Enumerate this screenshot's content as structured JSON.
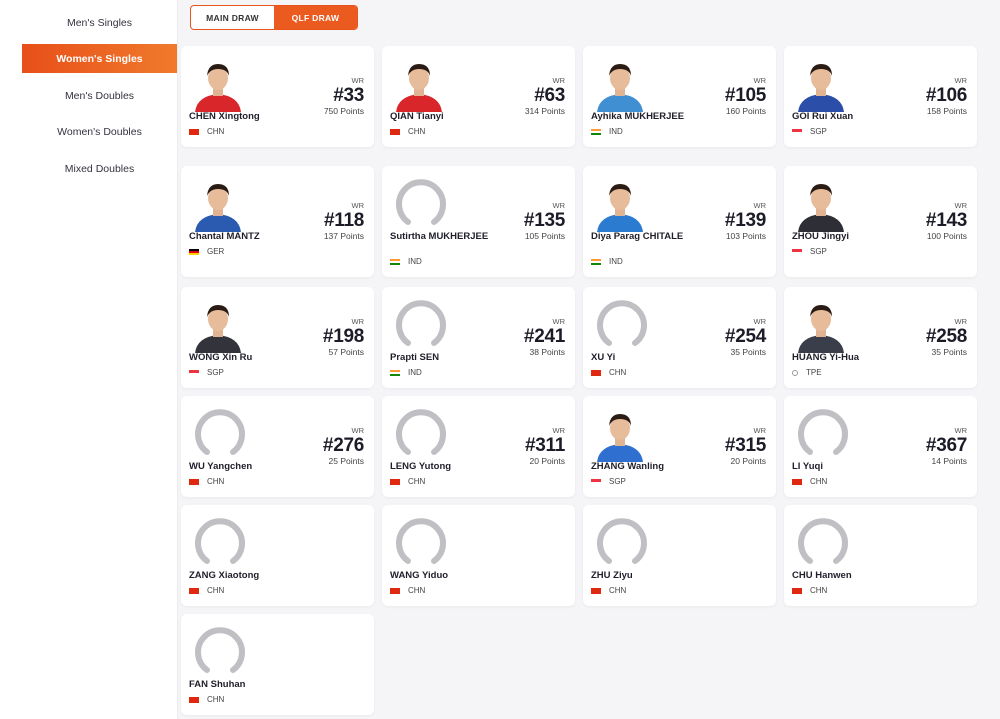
{
  "sidebar": {
    "items": [
      {
        "label": "Men's Singles",
        "active": false
      },
      {
        "label": "Women's Singles",
        "active": true
      },
      {
        "label": "Men's Doubles",
        "active": false
      },
      {
        "label": "Women's Doubles",
        "active": false
      },
      {
        "label": "Mixed Doubles",
        "active": false
      }
    ]
  },
  "tabs": [
    {
      "label": "MAIN DRAW",
      "active": false
    },
    {
      "label": "QLF DRAW",
      "active": true
    }
  ],
  "colors": {
    "accent": "#eb5a1f",
    "chn": "#de2910",
    "sgp": "#ef3340",
    "ind_saffron": "#ff9933",
    "ind_green": "#138808",
    "ger_black": "#000000",
    "ger_red": "#dd0000",
    "ger_gold": "#ffce00"
  },
  "players": [
    {
      "name": "CHEN Xingtong",
      "country": "CHN",
      "wr": "WR",
      "rank": "#33",
      "points": "750 Points",
      "photo": true,
      "shirt": "#d9262b"
    },
    {
      "name": "QIAN Tianyi",
      "country": "CHN",
      "wr": "WR",
      "rank": "#63",
      "points": "314 Points",
      "photo": true,
      "shirt": "#d9262b"
    },
    {
      "name": "Ayhika MUKHERJEE",
      "country": "IND",
      "wr": "WR",
      "rank": "#105",
      "points": "160 Points",
      "photo": true,
      "shirt": "#3f8fd2"
    },
    {
      "name": "GOI Rui Xuan",
      "country": "SGP",
      "wr": "WR",
      "rank": "#106",
      "points": "158 Points",
      "photo": true,
      "shirt": "#2b4fa8"
    },
    {
      "name": "Chantal MANTZ",
      "country": "GER",
      "wr": "WR",
      "rank": "#118",
      "points": "137 Points",
      "photo": true,
      "shirt": "#2a5bb0"
    },
    {
      "name": "Sutirtha MUKHERJEE",
      "country": "IND",
      "wr": "WR",
      "rank": "#135",
      "points": "105 Points",
      "photo": false
    },
    {
      "name": "Diya Parag CHITALE",
      "country": "IND",
      "wr": "WR",
      "rank": "#139",
      "points": "103 Points",
      "photo": true,
      "shirt": "#2b7bd1"
    },
    {
      "name": "ZHOU Jingyi",
      "country": "SGP",
      "wr": "WR",
      "rank": "#143",
      "points": "100 Points",
      "photo": true,
      "shirt": "#2e2e36"
    },
    {
      "name": "WONG Xin Ru",
      "country": "SGP",
      "wr": "WR",
      "rank": "#198",
      "points": "57 Points",
      "photo": true,
      "shirt": "#33333b"
    },
    {
      "name": "Prapti SEN",
      "country": "IND",
      "wr": "WR",
      "rank": "#241",
      "points": "38 Points",
      "photo": false
    },
    {
      "name": "XU Yi",
      "country": "CHN",
      "wr": "WR",
      "rank": "#254",
      "points": "35 Points",
      "photo": false
    },
    {
      "name": "HUANG Yi-Hua",
      "country": "TPE",
      "wr": "WR",
      "rank": "#258",
      "points": "35 Points",
      "photo": true,
      "shirt": "#3a3d4a"
    },
    {
      "name": "WU Yangchen",
      "country": "CHN",
      "wr": "WR",
      "rank": "#276",
      "points": "25 Points",
      "photo": false
    },
    {
      "name": "LENG Yutong",
      "country": "CHN",
      "wr": "WR",
      "rank": "#311",
      "points": "20 Points",
      "photo": false
    },
    {
      "name": "ZHANG Wanling",
      "country": "SGP",
      "wr": "WR",
      "rank": "#315",
      "points": "20 Points",
      "photo": true,
      "shirt": "#2f6fd0"
    },
    {
      "name": "LI Yuqi",
      "country": "CHN",
      "wr": "WR",
      "rank": "#367",
      "points": "14 Points",
      "photo": false
    },
    {
      "name": "ZANG Xiaotong",
      "country": "CHN",
      "wr": "",
      "rank": "",
      "points": "",
      "photo": false
    },
    {
      "name": "WANG Yiduo",
      "country": "CHN",
      "wr": "",
      "rank": "",
      "points": "",
      "photo": false
    },
    {
      "name": "ZHU Ziyu",
      "country": "CHN",
      "wr": "",
      "rank": "",
      "points": "",
      "photo": false
    },
    {
      "name": "CHU Hanwen",
      "country": "CHN",
      "wr": "",
      "rank": "",
      "points": "",
      "photo": false
    },
    {
      "name": "FAN Shuhan",
      "country": "CHN",
      "wr": "",
      "rank": "",
      "points": "",
      "photo": false
    }
  ]
}
